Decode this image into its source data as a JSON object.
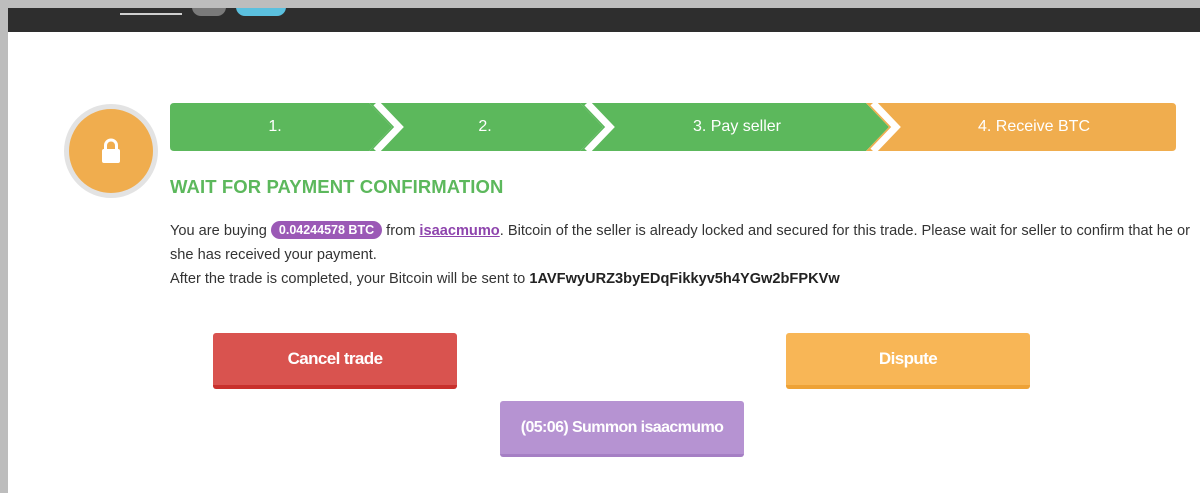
{
  "steps": [
    {
      "label": "1.",
      "status": "done"
    },
    {
      "label": "2.",
      "status": "done"
    },
    {
      "label": "3. Pay seller",
      "status": "done"
    },
    {
      "label": "4. Receive BTC",
      "status": "current"
    }
  ],
  "colors": {
    "step_done": "#5cb85c",
    "step_current": "#f0ad4e",
    "title": "#5cb85c",
    "badge": "#9b59b6",
    "cancel": "#d9534f",
    "dispute": "#f8b656",
    "summon": "#b693d2"
  },
  "status_icon": "lock-icon",
  "main": {
    "title": "WAIT FOR PAYMENT CONFIRMATION",
    "buying_prefix": "You are buying",
    "amount": "0.04244578 BTC",
    "from_word": "from",
    "seller": "isaacmumo",
    "message_rest": ". Bitcoin of the seller is already locked and secured for this trade. Please wait for seller to confirm that he or she has received your payment.",
    "after_text": "After the trade is completed, your Bitcoin will be sent to",
    "address": "1AVFwyURZ3byEDqFikkyv5h4YGw2bFPKVw"
  },
  "buttons": {
    "cancel": "Cancel trade",
    "dispute": "Dispute",
    "summon": "(05:06) Summon isaacmumo"
  }
}
